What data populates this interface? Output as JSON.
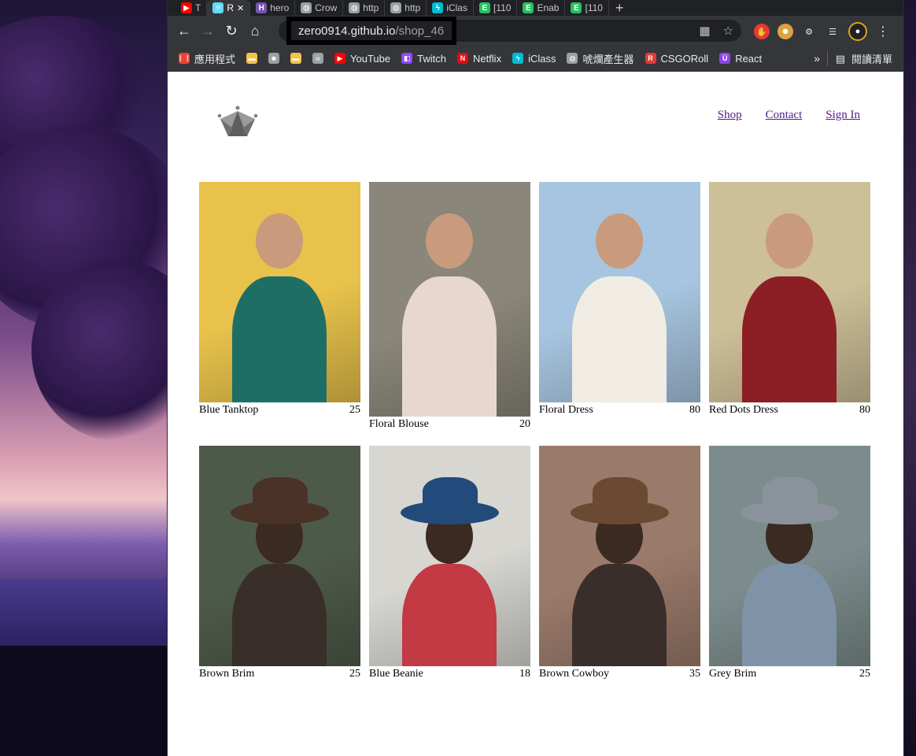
{
  "browser": {
    "tabs": [
      {
        "label": "T",
        "icon": "youtube-icon",
        "color": "#ff0000"
      },
      {
        "label": "R",
        "icon": "react-icon",
        "color": "#61dafb",
        "active": true
      },
      {
        "label": "hero",
        "icon": "heroku-icon",
        "color": "#7952b3"
      },
      {
        "label": "Crow",
        "icon": "globe-icon",
        "color": "#9aa0a6"
      },
      {
        "label": "http",
        "icon": "globe-icon",
        "color": "#9aa0a6"
      },
      {
        "label": "http",
        "icon": "globe-icon",
        "color": "#9aa0a6"
      },
      {
        "label": "iClas",
        "icon": "iclass-icon",
        "color": "#00bcd4"
      },
      {
        "label": "[110",
        "icon": "evernote-icon",
        "color": "#2dbe60"
      },
      {
        "label": "Enab",
        "icon": "evernote-icon",
        "color": "#2dbe60"
      },
      {
        "label": "[110",
        "icon": "evernote-icon",
        "color": "#2dbe60"
      }
    ],
    "new_tab": "+",
    "url_host": "zero0914.github.io",
    "url_path": "/shop_46",
    "bookmarks": [
      {
        "label": "應用程式",
        "icon": "apps-grid-icon",
        "color": "#ea4335"
      },
      {
        "label": "",
        "icon": "folder-icon",
        "color": "#f6c344"
      },
      {
        "label": "",
        "icon": "smiley-icon",
        "color": "#9aa0a6"
      },
      {
        "label": "",
        "icon": "folder-icon",
        "color": "#f6c344"
      },
      {
        "label": "",
        "icon": "skull-icon",
        "color": "#9aa0a6"
      },
      {
        "label": "YouTube",
        "icon": "youtube-icon",
        "color": "#ff0000"
      },
      {
        "label": "Twitch",
        "icon": "twitch-icon",
        "color": "#9146ff"
      },
      {
        "label": "Netflix",
        "icon": "netflix-icon",
        "color": "#e50914"
      },
      {
        "label": "iClass",
        "icon": "iclass-icon",
        "color": "#00bcd4"
      },
      {
        "label": "唬爛產生器",
        "icon": "globe-icon",
        "color": "#9aa0a6"
      },
      {
        "label": "CSGORoll",
        "icon": "csgoroll-icon",
        "color": "#e53935"
      },
      {
        "label": "React",
        "icon": "react-icon",
        "color": "#8e44ec"
      }
    ],
    "bookmarks_more": "»",
    "reading_list": "閱讀清單"
  },
  "site": {
    "logo": "crown-icon",
    "nav": {
      "shop": "Shop",
      "contact": "Contact",
      "sign_in": "Sign In"
    }
  },
  "products": [
    {
      "name": "Blue Tanktop",
      "price": "25",
      "bg": "#e8c24a",
      "accent": "#1e6e66"
    },
    {
      "name": "Floral Blouse",
      "price": "20",
      "bg": "#8a8679",
      "accent": "#e8d7cf"
    },
    {
      "name": "Floral Dress",
      "price": "80",
      "bg": "#a7c5e0",
      "accent": "#f1ece3"
    },
    {
      "name": "Red Dots Dress",
      "price": "80",
      "bg": "#cdbf98",
      "accent": "#8c1e26"
    },
    {
      "name": "Brown Brim",
      "price": "25",
      "bg": "#4e5a49",
      "accent": "#4a3227"
    },
    {
      "name": "Blue Beanie",
      "price": "18",
      "bg": "#d7d6d1",
      "accent": "#224a7a"
    },
    {
      "name": "Brown Cowboy",
      "price": "35",
      "bg": "#9a7a6a",
      "accent": "#6a4a33"
    },
    {
      "name": "Grey Brim",
      "price": "25",
      "bg": "#7c8c8c",
      "accent": "#8a939c"
    }
  ]
}
